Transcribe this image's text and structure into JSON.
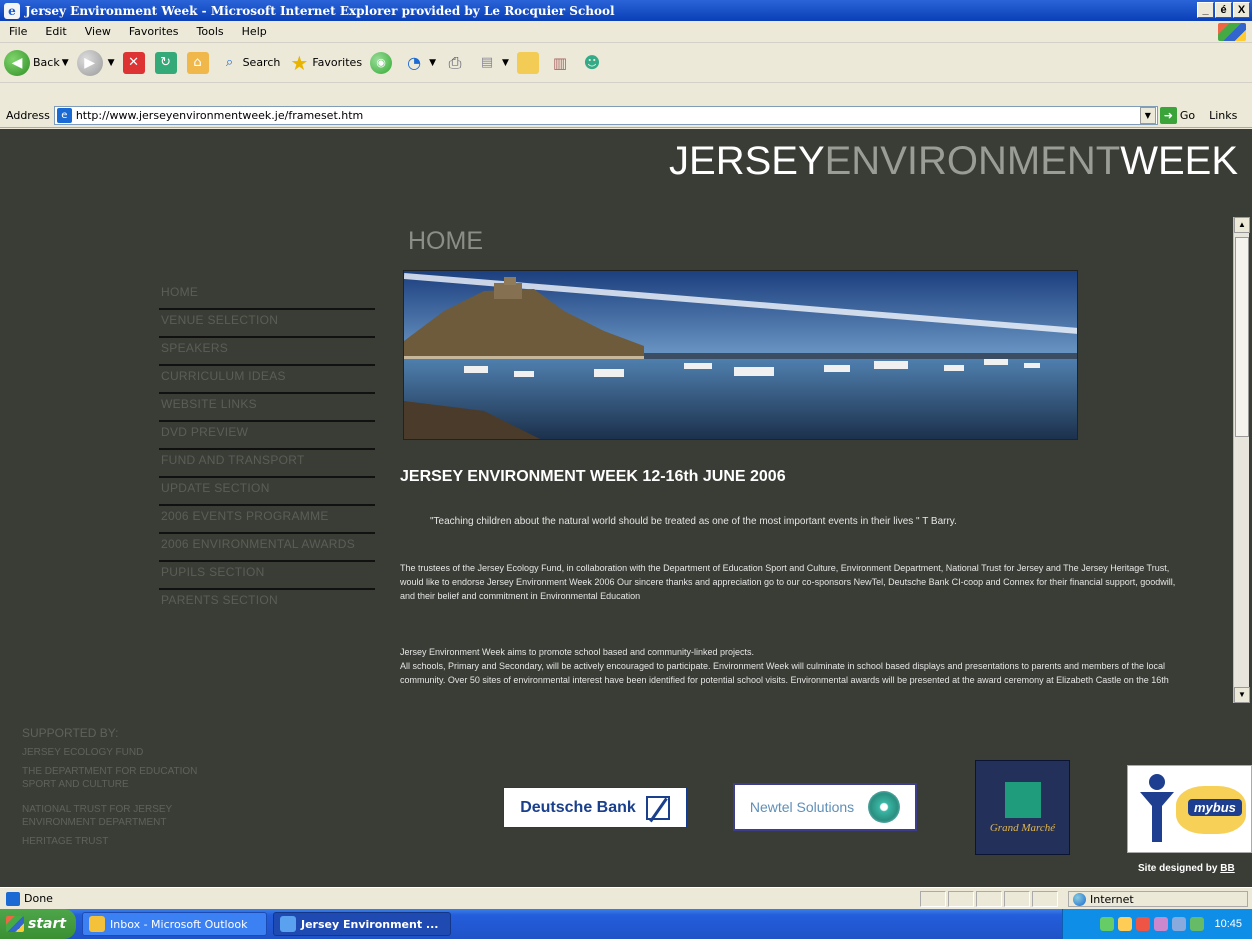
{
  "window": {
    "title": "Jersey Environment Week - Microsoft Internet Explorer provided by Le Rocquier School",
    "buttons": [
      "_",
      "é",
      "X"
    ]
  },
  "menu": [
    "File",
    "Edit",
    "View",
    "Favorites",
    "Tools",
    "Help"
  ],
  "toolbar": {
    "back": "Back",
    "search": "Search",
    "favorites": "Favorites"
  },
  "address": {
    "label": "Address",
    "url": "http://www.jerseyenvironmentweek.je/frameset.htm",
    "go": "Go",
    "links": "Links"
  },
  "site": {
    "brand_a": "JERSEY",
    "brand_b": "ENVIRONMENT",
    "brand_c": "WEEK",
    "page_heading": "HOME",
    "nav": [
      "HOME",
      "VENUE SELECTION",
      "SPEAKERS",
      "CURRICULUM IDEAS",
      "WEBSITE LINKS",
      "DVD PREVIEW",
      "FUND AND TRANSPORT",
      "UPDATE SECTION",
      "2006 EVENTS PROGRAMME",
      "2006 ENVIRONMENTAL AWARDS",
      "PUPILS SECTION",
      "PARENTS SECTION"
    ],
    "main_title": "JERSEY ENVIRONMENT WEEK 12-16th JUNE 2006",
    "quote": "\"Teaching children about the natural world should be treated as one of the most important events in their lives \" T Barry.",
    "para1": "The trustees of the Jersey Ecology Fund, in collaboration with the Department of Education Sport and Culture, Environment Department, National Trust for Jersey and The Jersey Heritage Trust, would like to endorse Jersey Environment Week 2006 Our sincere thanks and appreciation go to our co-sponsors NewTel, Deutsche Bank CI-coop and Connex for their financial support, goodwill, and their belief and commitment in Environmental Education",
    "para2a": "Jersey Environment Week aims to promote school based and community-linked projects.",
    "para2b": "All schools, Primary and Secondary, will be actively encouraged to participate. Environment Week will culminate in school based displays and presentations to parents and members of the local community. Over 50 sites of environmental interest have been identified for potential school visits. Environmental awards will be presented at the award ceremony at Elizabeth Castle on the 16th",
    "supported_heading": "SUPPORTED BY:",
    "supporters": [
      "JERSEY ECOLOGY FUND",
      "THE DEPARTMENT FOR EDUCATION",
      "SPORT AND CULTURE",
      "NATIONAL TRUST FOR JERSEY",
      "ENVIRONMENT DEPARTMENT",
      "HERITAGE TRUST"
    ],
    "sponsors": {
      "deutsche": "Deutsche Bank",
      "newtel": "Newtel Solutions",
      "grand": "Grand Marché",
      "mybus": "mybus"
    },
    "credit_prefix": "Site designed by ",
    "credit_link": "BB"
  },
  "status": {
    "text": "Done",
    "zone": "Internet"
  },
  "taskbar": {
    "start": "start",
    "task1": "Inbox - Microsoft Outlook",
    "task2": "Jersey Environment ...",
    "clock": "10:45"
  }
}
